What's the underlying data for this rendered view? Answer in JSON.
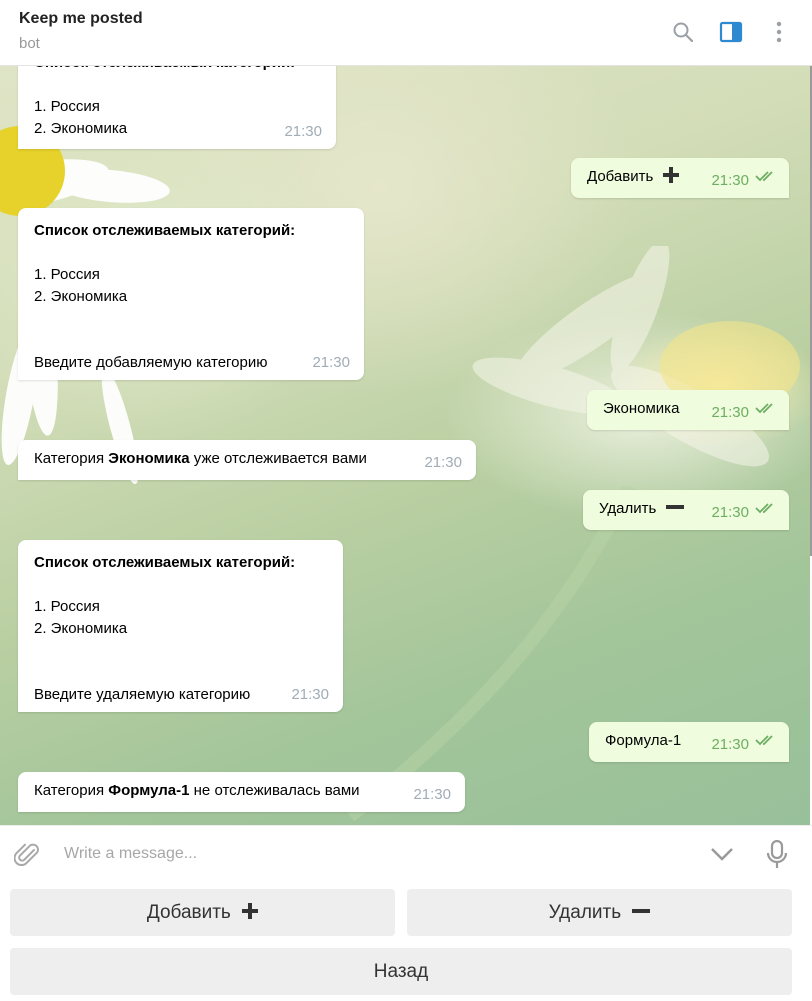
{
  "header": {
    "title": "Keep me posted",
    "subtitle": "bot"
  },
  "messages": [
    {
      "dir": "in",
      "title": "Список отслеживаемых категорий:",
      "items": [
        "1. Россия",
        "2. Экономика"
      ],
      "time": "21:30"
    },
    {
      "dir": "out",
      "text": "Добавить",
      "icon": "plus-icon",
      "time": "21:30"
    },
    {
      "dir": "in",
      "title": "Список отслеживаемых категорий:",
      "items": [
        "1. Россия",
        "2. Экономика"
      ],
      "prompt": "Введите добавляемую категорию",
      "time": "21:30"
    },
    {
      "dir": "out",
      "text": "Экономика",
      "time": "21:30"
    },
    {
      "dir": "in",
      "prefix": "Категория ",
      "bold": "Экономика",
      "suffix": " уже отслеживается вами",
      "time": "21:30"
    },
    {
      "dir": "out",
      "text": "Удалить",
      "icon": "minus-icon",
      "time": "21:30"
    },
    {
      "dir": "in",
      "title": "Список отслеживаемых категорий:",
      "items": [
        "1. Россия",
        "2. Экономика"
      ],
      "prompt": "Введите удаляемую категорию",
      "time": "21:30"
    },
    {
      "dir": "out",
      "text": "Формула-1",
      "time": "21:30"
    },
    {
      "dir": "in",
      "prefix": "Категория ",
      "bold": "Формула-1",
      "suffix": " не отслеживалась вами",
      "time": "21:30"
    }
  ],
  "input": {
    "placeholder": "Write a message..."
  },
  "keyboard": {
    "add_label": "Добавить",
    "remove_label": "Удалить",
    "back_label": "Назад"
  },
  "colors": {
    "outgoing_bubble": "#effdde",
    "incoming_bubble": "#ffffff",
    "accent": "#2f89d1",
    "read_check": "#6dae62"
  },
  "icons": [
    "search-icon",
    "sidebar-toggle-icon",
    "more-icon",
    "attach-icon",
    "chevron-down-icon",
    "microphone-icon",
    "plus-icon",
    "minus-icon",
    "double-check-icon"
  ]
}
